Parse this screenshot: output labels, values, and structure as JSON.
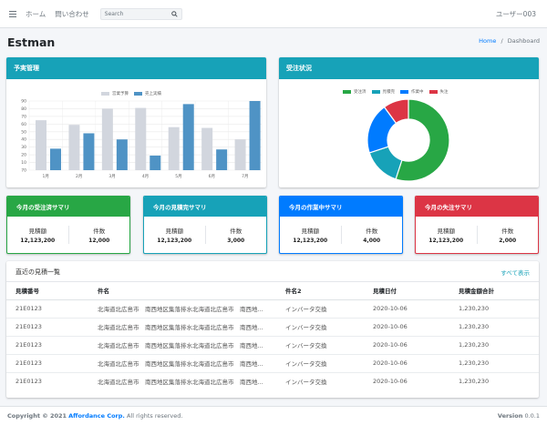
{
  "nav": {
    "home": "ホーム",
    "contact": "問い合わせ",
    "search_placeholder": "Search",
    "user": "ユーザー003"
  },
  "header": {
    "title": "Estman",
    "crumb_home": "Home",
    "crumb_sep": "/",
    "crumb_current": "Dashboard"
  },
  "budget_card": {
    "title": "予実管理"
  },
  "order_card": {
    "title": "受注状況"
  },
  "colors": {
    "teal": "#17a2b8",
    "green": "#28a745",
    "blue": "#007bff",
    "red": "#dc3545",
    "gray": "#d2d6de",
    "steel": "#4f93c5"
  },
  "chart_data": [
    {
      "type": "bar",
      "categories": [
        "1月",
        "2月",
        "3月",
        "4月",
        "5月",
        "6月",
        "7月"
      ],
      "series": [
        {
          "name": "営業予算",
          "values": [
            65,
            59,
            80,
            81,
            56,
            55,
            40
          ]
        },
        {
          "name": "売上実績",
          "values": [
            28,
            48,
            40,
            19,
            86,
            27,
            90
          ]
        }
      ],
      "yticks": [
        "70",
        "10",
        "20",
        "30",
        "40",
        "50",
        "60",
        "70",
        "80",
        "90"
      ],
      "ylim": [
        0,
        90
      ],
      "legend": "top-center",
      "grid": true
    },
    {
      "type": "pie",
      "labels": [
        "受注済",
        "見積完",
        "作業中",
        "失注"
      ],
      "values": [
        55,
        15,
        20,
        10
      ],
      "legend": "top-center"
    }
  ],
  "summaries": [
    {
      "title": "今月の受注済サマリ",
      "label1": "見積額",
      "value1": "12,123,200",
      "label2": "件数",
      "value2": "12,000"
    },
    {
      "title": "今月の見積完サマリ",
      "label1": "見積額",
      "value1": "12,123,200",
      "label2": "件数",
      "value2": "3,000"
    },
    {
      "title": "今月の作業中サマリ",
      "label1": "見積額",
      "value1": "12,123,200",
      "label2": "件数",
      "value2": "4,000"
    },
    {
      "title": "今月の失注サマリ",
      "label1": "見積額",
      "value1": "12,123,200",
      "label2": "件数",
      "value2": "2,000"
    }
  ],
  "recent": {
    "title": "直近の見積一覧",
    "show_all": "すべて表示",
    "columns": [
      "見積番号",
      "件名",
      "件名2",
      "見積日付",
      "見積金額合計"
    ],
    "rows": [
      [
        "21E0123",
        "北海道北広島市　南西地区集落排水北海道北広島市　南西地...",
        "インバータ交換",
        "2020-10-06",
        "1,230,230"
      ],
      [
        "21E0123",
        "北海道北広島市　南西地区集落排水北海道北広島市　南西地...",
        "インバータ交換",
        "2020-10-06",
        "1,230,230"
      ],
      [
        "21E0123",
        "北海道北広島市　南西地区集落排水北海道北広島市　南西地...",
        "インバータ交換",
        "2020-10-06",
        "1,230,230"
      ],
      [
        "21E0123",
        "北海道北広島市　南西地区集落排水北海道北広島市　南西地...",
        "インバータ交換",
        "2020-10-06",
        "1,230,230"
      ],
      [
        "21E0123",
        "北海道北広島市　南西地区集落排水北海道北広島市　南西地...",
        "インバータ交換",
        "2020-10-06",
        "1,230,230"
      ]
    ]
  },
  "footer": {
    "copyright": "Copyright © 2021",
    "company": "Affordance Corp.",
    "rights": "All rights reserved.",
    "version_label": "Version",
    "version": "0.0.1"
  }
}
